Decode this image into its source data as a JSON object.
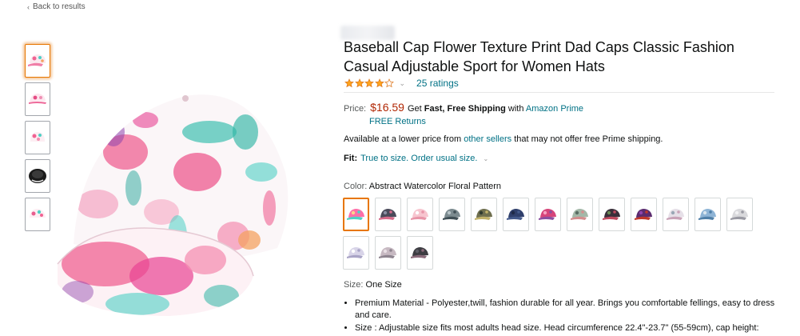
{
  "nav": {
    "back_label": "Back to results"
  },
  "gallery": {
    "thumbnails": [
      {
        "name": "floral-front"
      },
      {
        "name": "floral-side"
      },
      {
        "name": "floral-back"
      },
      {
        "name": "black-inside"
      },
      {
        "name": "floral-top"
      }
    ]
  },
  "product": {
    "title": "Baseball Cap Flower Texture Print Dad Caps Classic Fashion Casual Adjustable Sport for Women Hats",
    "rating": {
      "stars": 4.0,
      "out_of": 5,
      "count_text": "25 ratings"
    },
    "price": {
      "label": "Price:",
      "amount": "$16.59",
      "shipping_prefix": "Get",
      "shipping_bold": "Fast, Free Shipping",
      "shipping_with": "with",
      "prime_link": "Amazon Prime",
      "returns": "FREE Returns"
    },
    "availability": {
      "prefix": "Available at a lower price from",
      "link": "other sellers",
      "suffix": "that may not offer free Prime shipping."
    },
    "fit": {
      "label": "Fit:",
      "value": "True to size. Order usual size."
    },
    "color": {
      "label": "Color:",
      "value": "Abstract Watercolor Floral Pattern"
    },
    "size": {
      "label": "Size:",
      "value": "One Size"
    },
    "bullets": [
      "Premium Material - Polyester,twill, fashion durable for all year. Brings you comfortable fellings, easy to dress and care.",
      "Size : Adjustable size fits most adults head size. Head circumference 22.4\"-23.7\" (55-59cm), cap height:"
    ]
  },
  "swatches": [
    {
      "name": "abstract-watercolor-floral",
      "colors": [
        "#ff6fa8",
        "#4fd1c5",
        "#fbd38d"
      ]
    },
    {
      "name": "dark-floral",
      "colors": [
        "#4a4a5a",
        "#d66a8a",
        "#8b8fa3"
      ]
    },
    {
      "name": "pink-blossom",
      "colors": [
        "#f7c5cf",
        "#e895a8",
        "#ffffff"
      ]
    },
    {
      "name": "gray-pattern",
      "colors": [
        "#7b8a8f",
        "#3f4e55",
        "#b8c4c8"
      ]
    },
    {
      "name": "olive-floral",
      "colors": [
        "#6e6e4e",
        "#c2b26a",
        "#2f3a2f"
      ]
    },
    {
      "name": "navy-denim",
      "colors": [
        "#2f3f6b",
        "#445a8c",
        "#1f2a48"
      ]
    },
    {
      "name": "rose-purple",
      "colors": [
        "#d6457a",
        "#8a4fa0",
        "#f5a3c0"
      ]
    },
    {
      "name": "muted-flowers",
      "colors": [
        "#a3b8a8",
        "#d38e8e",
        "#5a6d63"
      ]
    },
    {
      "name": "dark-roses",
      "colors": [
        "#3a2f3a",
        "#c04a5f",
        "#6a8a55"
      ]
    },
    {
      "name": "purple-red",
      "colors": [
        "#5b2c6f",
        "#c0392b",
        "#8e44ad"
      ]
    },
    {
      "name": "pale-floral",
      "colors": [
        "#e6e0e8",
        "#c9a3b8",
        "#9aa7b5"
      ]
    },
    {
      "name": "blue-floral",
      "colors": [
        "#8eb4d6",
        "#4f7fa8",
        "#d7e4ee"
      ]
    },
    {
      "name": "light-gray-floral",
      "colors": [
        "#d9d9dc",
        "#9a9aa3",
        "#f1f1f3"
      ]
    },
    {
      "name": "lavender-white",
      "colors": [
        "#d8d4e8",
        "#a9a4c6",
        "#ffffff"
      ]
    },
    {
      "name": "blush-gray",
      "colors": [
        "#c7b9c2",
        "#8f8590",
        "#e8dfe4"
      ]
    },
    {
      "name": "charcoal-floral",
      "colors": [
        "#3d3d42",
        "#8a6a7a",
        "#5e5e66"
      ]
    }
  ]
}
